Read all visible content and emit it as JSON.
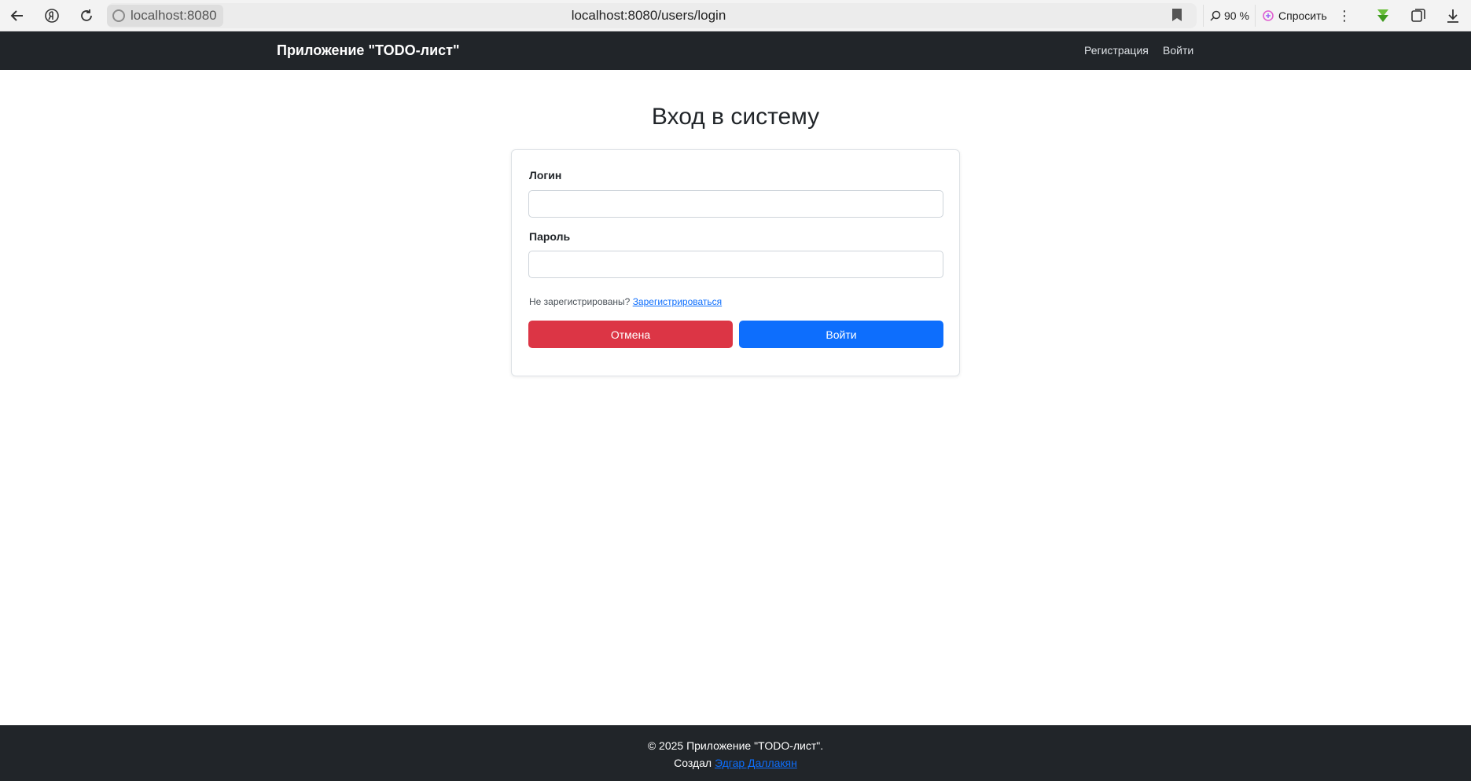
{
  "browser": {
    "site_chip": "localhost:8080",
    "url": "localhost:8080/users/login",
    "zoom": "90 %",
    "ask_label": "Спросить"
  },
  "navbar": {
    "brand": "Приложение \"TODO-лист\"",
    "register_link": "Регистрация",
    "login_link": "Войти"
  },
  "main": {
    "title": "Вход в систему",
    "login_label": "Логин",
    "password_label": "Пароль",
    "hint_text": "Не зарегистрированы?",
    "hint_link": "Зарегистрироваться",
    "cancel_button": "Отмена",
    "submit_button": "Войти"
  },
  "footer": {
    "line1": "© 2025 Приложение \"TODO-лист\".",
    "created_by": "Создал",
    "author": "Эдгар Даллакян"
  },
  "colors": {
    "navbar_bg": "#212529",
    "danger": "#dc3545",
    "primary": "#0d6efd"
  }
}
